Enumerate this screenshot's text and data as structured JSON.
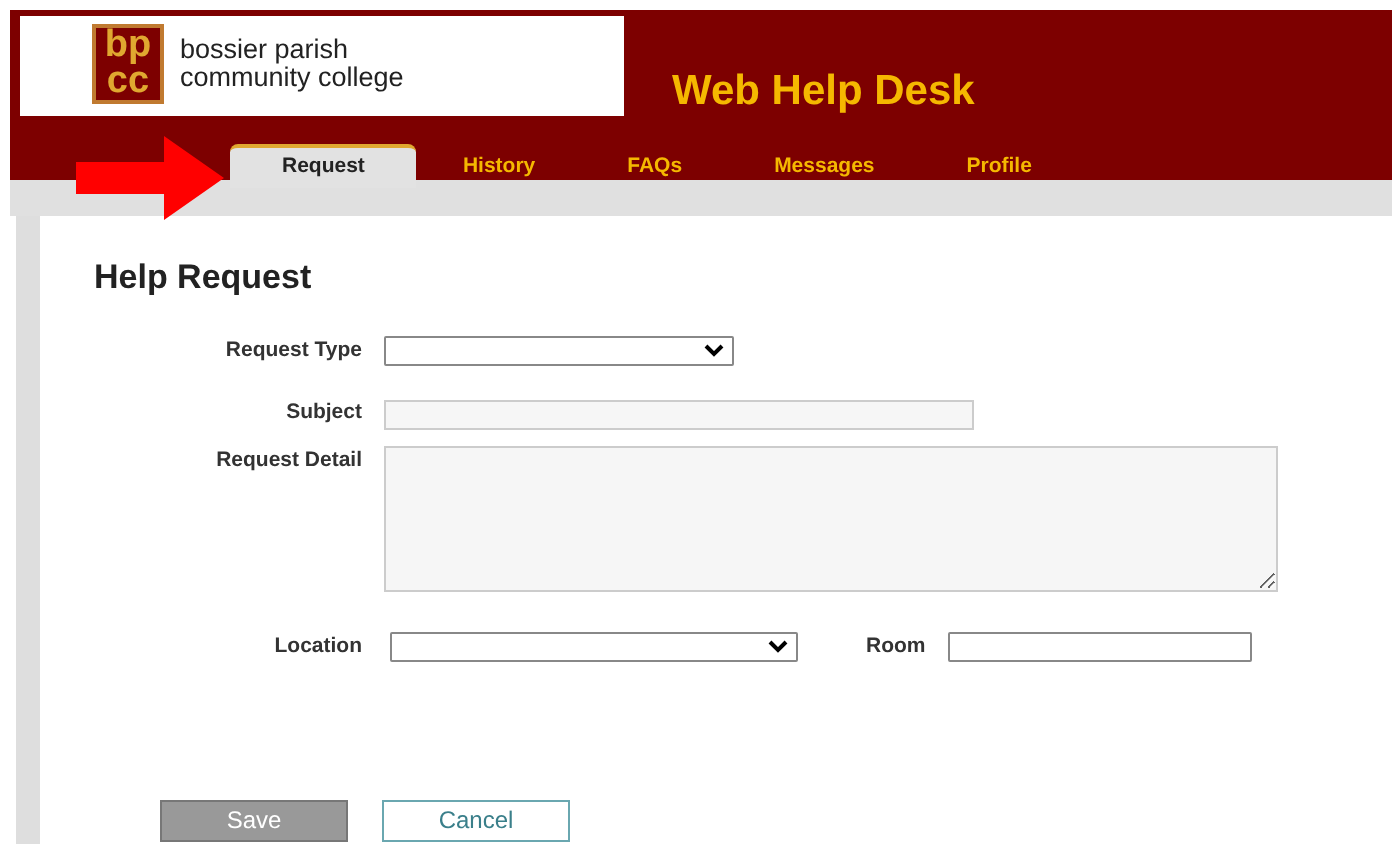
{
  "header": {
    "logo_mark": [
      "bp",
      "cc"
    ],
    "logo_text": [
      "bossier parish",
      "community college"
    ],
    "title": "Web Help Desk"
  },
  "tabs": [
    {
      "label": "Request",
      "selected": true
    },
    {
      "label": "History",
      "selected": false
    },
    {
      "label": "FAQs",
      "selected": false
    },
    {
      "label": "Messages",
      "selected": false
    },
    {
      "label": "Profile",
      "selected": false
    }
  ],
  "form": {
    "title": "Help Request",
    "request_type": {
      "label": "Request Type"
    },
    "subject": {
      "label": "Subject"
    },
    "request_detail": {
      "label": "Request Detail"
    },
    "location": {
      "label": "Location"
    },
    "room": {
      "label": "Room"
    }
  },
  "buttons": [
    {
      "label": "Save",
      "kind": "primary"
    },
    {
      "label": "Cancel",
      "kind": "secondary"
    }
  ]
}
